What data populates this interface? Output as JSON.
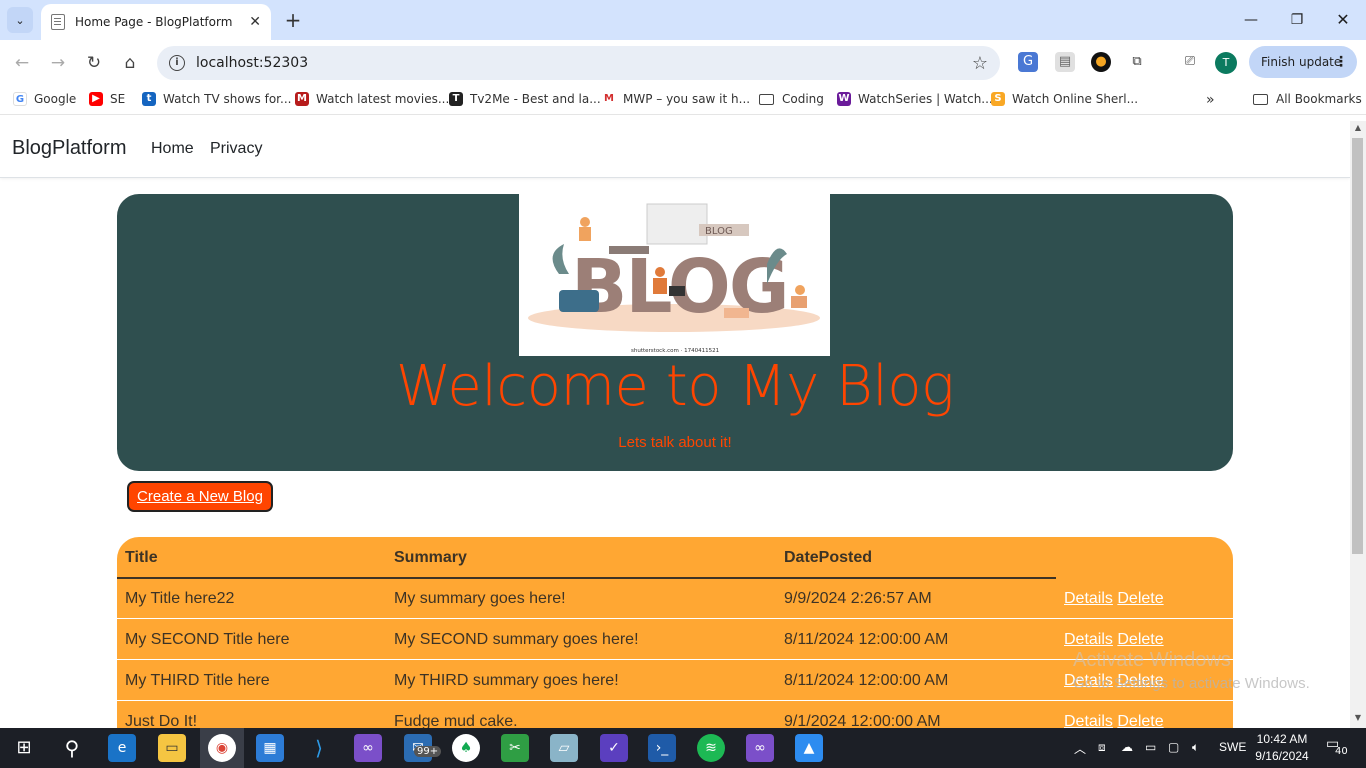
{
  "browser": {
    "tab_title": "Home Page - BlogPlatform",
    "url": "localhost:52303",
    "finish_update_label": "Finish update",
    "profile_initial": "T",
    "bookmarks": [
      {
        "label": "Google",
        "icon": "google-icon",
        "color": "#4285f4"
      },
      {
        "label": "SE",
        "icon": "youtube-icon",
        "color": "#ff0000"
      },
      {
        "label": "Watch TV shows for...",
        "icon": "tv-icon",
        "color": "#1565c0"
      },
      {
        "label": "Watch latest movies...",
        "icon": "movies-icon",
        "color": "#b71c1c"
      },
      {
        "label": "Tv2Me - Best and la...",
        "icon": "tv2me-icon",
        "color": "#222222"
      },
      {
        "label": "MWP – you saw it h...",
        "icon": "mwp-icon",
        "color": "#d32f2f"
      },
      {
        "label": "Coding",
        "icon": "folder-icon",
        "color": "#444444"
      },
      {
        "label": "WatchSeries | Watch...",
        "icon": "watchseries-icon",
        "color": "#6a1b9a"
      },
      {
        "label": "Watch Online Sherl...",
        "icon": "sherlock-icon",
        "color": "#f9a825"
      }
    ],
    "all_bookmarks_label": "All Bookmarks"
  },
  "site": {
    "brand": "BlogPlatform",
    "nav": [
      "Home",
      "Privacy"
    ]
  },
  "hero": {
    "image_text": "BLOG",
    "image_sign": "BLOG",
    "image_credit": "shutterstock.com · 1740411521",
    "title": "Welcome to My Blog",
    "subtitle": "Lets talk about it!",
    "bg_color": "#2f4f4f",
    "accent_color": "#ff4500"
  },
  "create_button": "Create a New Blog",
  "table": {
    "headers": [
      "Title",
      "Summary",
      "DatePosted"
    ],
    "bg_color": "#ffa733",
    "rows": [
      {
        "title": "My Title here22",
        "summary": "My summary goes here!",
        "date": "9/9/2024 2:26:57 AM",
        "details": "Details",
        "delete": "Delete"
      },
      {
        "title": "My SECOND Title here",
        "summary": "My SECOND summary goes here!",
        "date": "8/11/2024 12:00:00 AM",
        "details": "Details",
        "delete": "Delete"
      },
      {
        "title": "My THIRD Title here",
        "summary": "My THIRD summary goes here!",
        "date": "8/11/2024 12:00:00 AM",
        "details": "Details",
        "delete": "Delete"
      },
      {
        "title": "Just Do It!",
        "summary": "Fudge mud cake.",
        "date": "9/1/2024 12:00:00 AM",
        "details": "Details",
        "delete": "Delete"
      }
    ]
  },
  "watermark": {
    "line1": "Activate Windows",
    "line2": "Go to Settings to activate Windows."
  },
  "taskbar": {
    "mail_badge": "99+",
    "language": "SWE",
    "time": "10:42 AM",
    "date": "9/16/2024",
    "notification_count": "40"
  }
}
